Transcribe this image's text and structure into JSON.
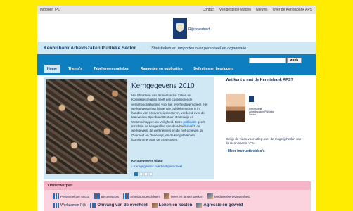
{
  "topbar": {
    "login": "Inloggen IPD",
    "links": [
      "Contact",
      "Veelgestelde vragen",
      "Nieuws",
      "Over de Kennisbank APS"
    ]
  },
  "logo": {
    "text": "Rijksoverheid"
  },
  "header": {
    "org": "Kennisbank Arbeidszaken Publieke Sector",
    "tagline": "Statistieken en rapporten over personeel en organisatie"
  },
  "search": {
    "placeholder": "",
    "button": "zoek"
  },
  "tabs": [
    {
      "label": "Home",
      "active": true
    },
    {
      "label": "Thema's"
    },
    {
      "label": "Tabellen en grafieken"
    },
    {
      "label": "Rapporten en publicaties"
    },
    {
      "label": "Definities en begrippen"
    }
  ],
  "slide": {
    "title": "Kerngegevens 2010",
    "body_before": "Het Ministerie van Binnenlandse Zaken en Koninkrijksrelaties heeft een coördinerende verantwoordelijkheid voor het overheidspersoneel. Het werkgeversschap binnen de publieke sector is in handen van 14 overheidssectoren, verdeeld over de teakvelden Openbaar Bestuur, Onderwijs en Wetenschappen en Veiligheid. Deze ",
    "body_link": "publicatie",
    "body_after": " geeft inzicht in de kengetallen van de arbeidsmarkt, de werkgevers, de werknemers en de niet-actieven bij Overheid en Onderwijs, en de kengetallen en loonsommen van de 14 sectoren.",
    "sub": "Kerngegevens (data)",
    "link": "› Kerngegevens overheidspersoneel",
    "dots": 4,
    "active_dot": 0
  },
  "aside": {
    "title": "Wat kunt u met de Kennisbank APS?",
    "video_caption": "Kennisbank Arbeidszaken Publieke Sector",
    "text": "Bekijk de video voor uitleg over de mogelijkheden van de Kennisbank APS.",
    "link": "› Meer instructievideo's"
  },
  "onderwerpen": {
    "title": "Onderwerpen",
    "row1": [
      {
        "label": "Personeel per sector",
        "icon": "chart-icon"
      },
      {
        "label": "Beroepstrots",
        "icon": "chart-icon"
      },
      {
        "label": "Arbeidsongeschikten",
        "icon": "chart-icon"
      },
      {
        "label": "Meer en langer werken",
        "icon": "photo-icon"
      },
      {
        "label": "Medewerkertevredenheid",
        "icon": "photo-icon"
      }
    ],
    "row2": [
      {
        "label": "Werkzamen Rijk",
        "icon": "chart-icon"
      },
      {
        "label": "Omvang van de overheid",
        "icon": "chart-icon"
      },
      {
        "label": "Lonen en kosten",
        "icon": "photo-icon"
      },
      {
        "label": "Agressie en geweld",
        "icon": "photo-icon"
      }
    ]
  }
}
